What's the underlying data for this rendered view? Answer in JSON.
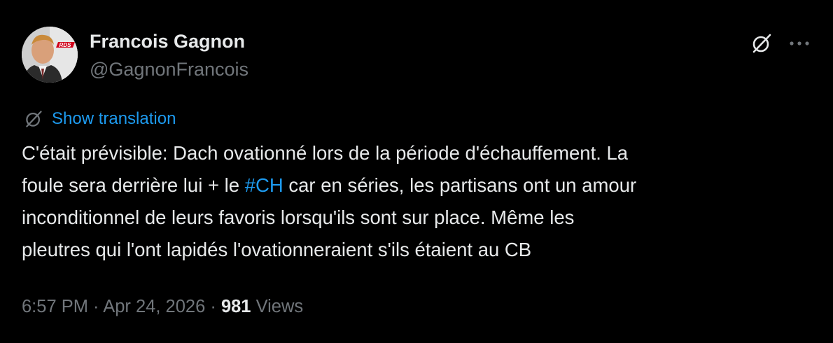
{
  "author": {
    "display_name": "Francois Gagnon",
    "handle": "@GagnonFrancois",
    "avatar_badge": "RDS"
  },
  "actions": {
    "grok_icon": "grok-icon",
    "more_icon": "more-horizontal-icon"
  },
  "translation": {
    "label": "Show translation",
    "icon": "grok-icon"
  },
  "tweet": {
    "line1": "C'était prévisible: Dach ovationné lors de la période d'échauffement. La",
    "line2_before": "foule sera derrière lui + le ",
    "hashtag": "#CH",
    "line2_after": " car en séries, les partisans ont un amour",
    "line3": "inconditionnel de leurs favoris lorsqu'ils sont sur place. Même les",
    "line4": "pleutres qui l'ont lapidés l'ovationneraient s'ils étaient au CB"
  },
  "meta": {
    "time": "6:57 PM",
    "separator": " · ",
    "date": "Apr 24, 2026",
    "views_count": "981",
    "views_label": " Views"
  },
  "colors": {
    "background": "#000000",
    "text_primary": "#e7e9ea",
    "text_secondary": "#71767b",
    "link": "#1d9bf0"
  }
}
